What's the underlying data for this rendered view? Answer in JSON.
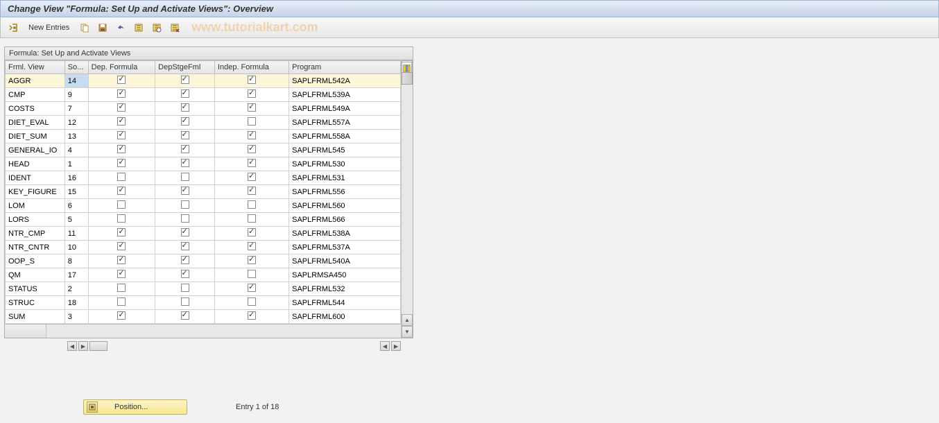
{
  "title": "Change View \"Formula: Set Up and Activate Views\": Overview",
  "toolbar": {
    "new_entries": "New Entries"
  },
  "watermark": "www.tutorialkart.com",
  "grid": {
    "title": "Formula: Set Up and Activate Views",
    "headers": {
      "frml": "Frml. View",
      "so": "So...",
      "dep": "Dep. Formula",
      "stge": "DepStgeFml",
      "indep": "Indep. Formula",
      "prog": "Program"
    },
    "rows": [
      {
        "frml": "AGGR",
        "so": "14",
        "dep": true,
        "stge": true,
        "indep": true,
        "prog": "SAPLFRML542A",
        "selected": true,
        "cellsel": true
      },
      {
        "frml": "CMP",
        "so": "9",
        "dep": true,
        "stge": true,
        "indep": true,
        "prog": "SAPLFRML539A"
      },
      {
        "frml": "COSTS",
        "so": "7",
        "dep": true,
        "stge": true,
        "indep": true,
        "prog": "SAPLFRML549A"
      },
      {
        "frml": "DIET_EVAL",
        "so": "12",
        "dep": true,
        "stge": true,
        "indep": false,
        "prog": "SAPLFRML557A"
      },
      {
        "frml": "DIET_SUM",
        "so": "13",
        "dep": true,
        "stge": true,
        "indep": true,
        "prog": "SAPLFRML558A"
      },
      {
        "frml": "GENERAL_IO",
        "so": "4",
        "dep": true,
        "stge": true,
        "indep": true,
        "prog": "SAPLFRML545"
      },
      {
        "frml": "HEAD",
        "so": "1",
        "dep": true,
        "stge": true,
        "indep": true,
        "prog": "SAPLFRML530"
      },
      {
        "frml": "IDENT",
        "so": "16",
        "dep": false,
        "stge": false,
        "indep": true,
        "prog": "SAPLFRML531"
      },
      {
        "frml": "KEY_FIGURE",
        "so": "15",
        "dep": true,
        "stge": true,
        "indep": true,
        "prog": "SAPLFRML556"
      },
      {
        "frml": "LOM",
        "so": "6",
        "dep": false,
        "stge": false,
        "indep": false,
        "prog": "SAPLFRML560"
      },
      {
        "frml": "LORS",
        "so": "5",
        "dep": false,
        "stge": false,
        "indep": false,
        "prog": "SAPLFRML566"
      },
      {
        "frml": "NTR_CMP",
        "so": "11",
        "dep": true,
        "stge": true,
        "indep": true,
        "prog": "SAPLFRML538A"
      },
      {
        "frml": "NTR_CNTR",
        "so": "10",
        "dep": true,
        "stge": true,
        "indep": true,
        "prog": "SAPLFRML537A"
      },
      {
        "frml": "OOP_S",
        "so": "8",
        "dep": true,
        "stge": true,
        "indep": true,
        "prog": "SAPLFRML540A"
      },
      {
        "frml": "QM",
        "so": "17",
        "dep": true,
        "stge": true,
        "indep": false,
        "prog": "SAPLRMSA450"
      },
      {
        "frml": "STATUS",
        "so": "2",
        "dep": false,
        "stge": false,
        "indep": true,
        "prog": "SAPLFRML532"
      },
      {
        "frml": "STRUC",
        "so": "18",
        "dep": false,
        "stge": false,
        "indep": false,
        "prog": "SAPLFRML544"
      },
      {
        "frml": "SUM",
        "so": "3",
        "dep": true,
        "stge": true,
        "indep": true,
        "prog": "SAPLFRML600"
      }
    ]
  },
  "footer": {
    "position": "Position...",
    "entry": "Entry 1 of 18"
  }
}
